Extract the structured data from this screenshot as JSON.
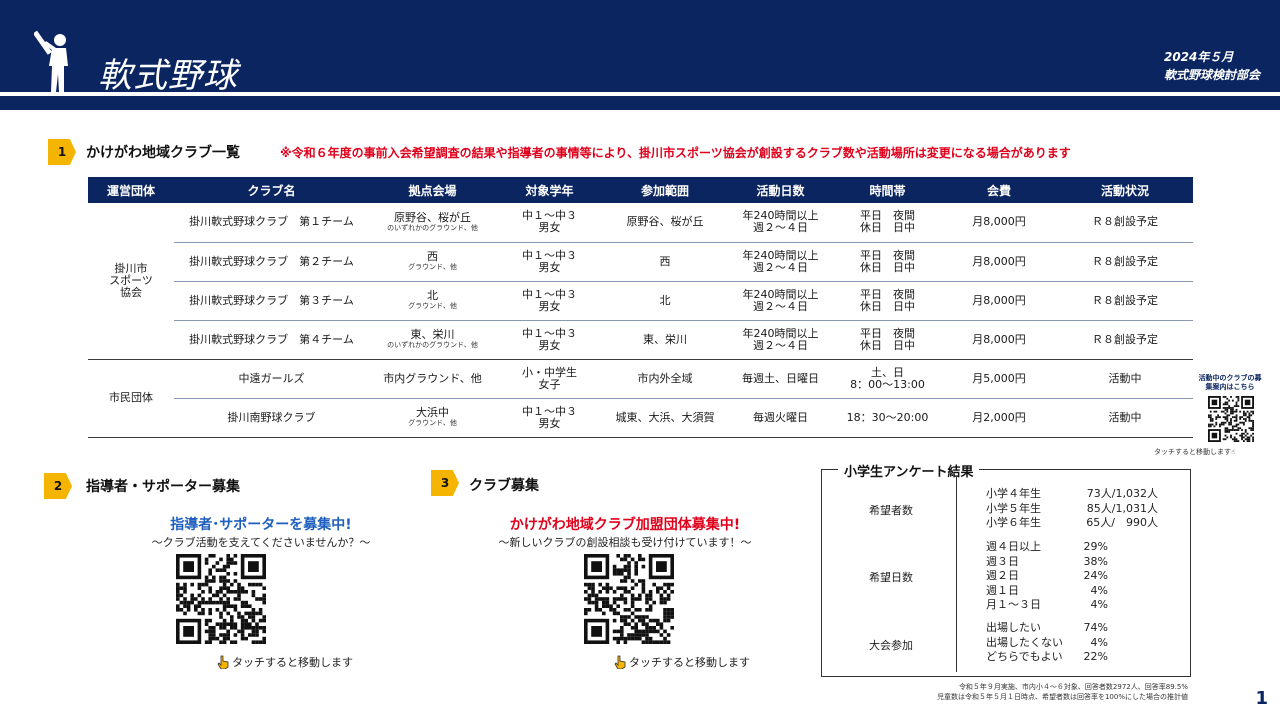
{
  "header": {
    "title": "軟式野球",
    "date": "2024年５月",
    "org": "軟式野球検討部会"
  },
  "section1": {
    "num": "1",
    "title": "かけがわ地域クラブ一覧",
    "notice": "※令和６年度の事前入会希望調査の結果や指導者の事情等により、掛川市スポーツ協会が創設するクラブ数や活動場所は変更になる場合があります"
  },
  "table": {
    "headers": [
      "運営団体",
      "クラブ名",
      "拠点会場",
      "対象学年",
      "参加範囲",
      "活動日数",
      "時間帯",
      "会費",
      "活動状況"
    ],
    "groups": [
      {
        "org": "掛川市\nスポーツ\n協会",
        "rows": [
          {
            "name": "掛川軟式野球クラブ　第１チーム",
            "venue": "原野谷、桜が丘",
            "venue_sub": "のいずれかのグラウンド、他",
            "grade": "中１～中３",
            "gender": "男女",
            "area": "原野谷、桜が丘",
            "days1": "年240時間以上",
            "days2": "週２～４日",
            "time1": "平日　夜間",
            "time2": "休日　日中",
            "fee": "月8,000円",
            "status": "Ｒ８創設予定"
          },
          {
            "name": "掛川軟式野球クラブ　第２チーム",
            "venue": "西",
            "venue_sub": "グラウンド、他",
            "grade": "中１～中３",
            "gender": "男女",
            "area": "西",
            "days1": "年240時間以上",
            "days2": "週２～４日",
            "time1": "平日　夜間",
            "time2": "休日　日中",
            "fee": "月8,000円",
            "status": "Ｒ８創設予定"
          },
          {
            "name": "掛川軟式野球クラブ　第３チーム",
            "venue": "北",
            "venue_sub": "グラウンド、他",
            "grade": "中１～中３",
            "gender": "男女",
            "area": "北",
            "days1": "年240時間以上",
            "days2": "週２～４日",
            "time1": "平日　夜間",
            "time2": "休日　日中",
            "fee": "月8,000円",
            "status": "Ｒ８創設予定"
          },
          {
            "name": "掛川軟式野球クラブ　第４チーム",
            "venue": "東、栄川",
            "venue_sub": "のいずれかのグラウンド、他",
            "grade": "中１～中３",
            "gender": "男女",
            "area": "東、栄川",
            "days1": "年240時間以上",
            "days2": "週２～４日",
            "time1": "平日　夜間",
            "time2": "休日　日中",
            "fee": "月8,000円",
            "status": "Ｒ８創設予定"
          }
        ]
      },
      {
        "org": "市民団体",
        "rows": [
          {
            "name": "中遠ガールズ",
            "venue": "市内グラウンド、他",
            "venue_sub": "",
            "grade": "小・中学生",
            "gender": "女子",
            "area": "市内外全域",
            "days1": "毎週土、日曜日",
            "days2": "",
            "time1": "土、日",
            "time2": "8：00～13:00",
            "fee": "月5,000円",
            "status": "活動中"
          },
          {
            "name": "掛川南野球クラブ",
            "venue": "大浜中",
            "venue_sub": "グラウンド、他",
            "grade": "中１～中３",
            "gender": "男女",
            "area": "城東、大浜、大須賀",
            "days1": "毎週火曜日",
            "days2": "",
            "time1": "18：30～20:00",
            "time2": "",
            "fee": "月2,000円",
            "status": "活動中"
          }
        ]
      }
    ]
  },
  "side_qr": {
    "caption": "活動中のクラブの募集案内はこちら",
    "touch": "タッチすると移動します"
  },
  "section2": {
    "num": "2",
    "title": "指導者・サポーター募集",
    "head": "指導者･サポーターを募集中!",
    "head_color": "#1f5fbf",
    "sub": "～クラブ活動を支えてくださいませんか？～",
    "touch": "タッチすると移動します"
  },
  "section3": {
    "num": "3",
    "title": "クラブ募集",
    "head": "かけがわ地域クラブ加盟団体募集中!",
    "head_color": "#e0001b",
    "sub": "～新しいクラブの創設相談も受け付けています！～",
    "touch": "タッチすると移動します"
  },
  "survey": {
    "title": "小学生アンケート結果",
    "categories": [
      {
        "label": "希望者数",
        "rows": [
          {
            "k": "小学４年生",
            "v": "73人/1,032人"
          },
          {
            "k": "小学５年生",
            "v": "85人/1,031人"
          },
          {
            "k": "小学６年生",
            "v": "65人/　990人"
          }
        ]
      },
      {
        "label": "希望日数",
        "rows": [
          {
            "k": "週４日以上",
            "v": "29%"
          },
          {
            "k": "週３日",
            "v": "38%"
          },
          {
            "k": "週２日",
            "v": "24%"
          },
          {
            "k": "週１日",
            "v": "4%"
          },
          {
            "k": "月１～３日",
            "v": "4%"
          }
        ]
      },
      {
        "label": "大会参加",
        "rows": [
          {
            "k": "出場したい",
            "v": "74%"
          },
          {
            "k": "出場したくない",
            "v": "4%"
          },
          {
            "k": "どちらでもよい",
            "v": "22%"
          }
        ]
      }
    ],
    "footnote1": "令和５年９月実施、市内小４～６対象、回答者数2972人、回答率89.5%",
    "footnote2": "児童数は令和５年５月１日時点、希望者数は回答率を100%にした場合の推計値"
  },
  "page_number": "1"
}
